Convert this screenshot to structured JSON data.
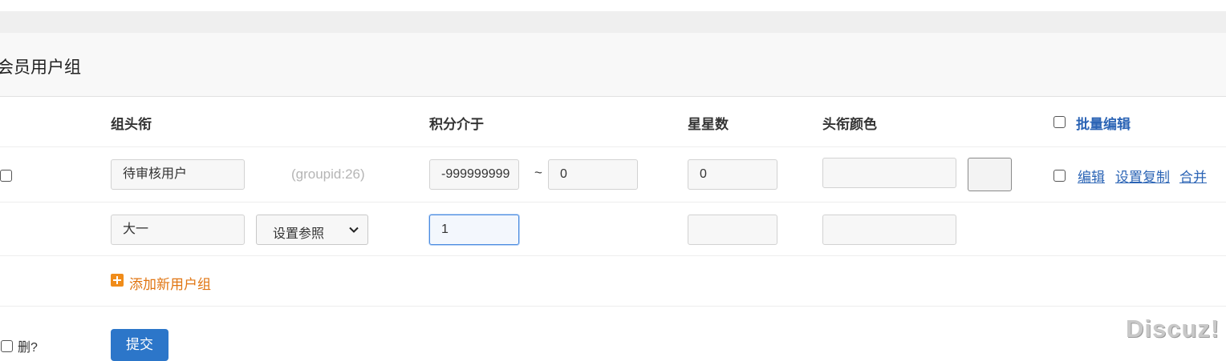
{
  "section": {
    "title": "会员用户组"
  },
  "columns": {
    "group_title": "组头衔",
    "credits_between": "积分介于",
    "stars": "星星数",
    "title_color": "头衔颜色",
    "batch_edit": "批量编辑"
  },
  "rows": [
    {
      "name": "待审核用户",
      "groupid": "(groupid:26)",
      "credits_min": "-999999999",
      "range_separator": "~",
      "credits_max": "0",
      "stars": "0",
      "color": "",
      "actions": {
        "edit": "编辑",
        "copy_settings": "设置复制",
        "merge": "合并"
      }
    },
    {
      "name": "大一",
      "reference": {
        "selected": "设置参照"
      },
      "credits_min": "1",
      "stars": "",
      "color": ""
    }
  ],
  "add_new": {
    "label": "添加新用户组"
  },
  "footer": {
    "delete_label": "删?",
    "submit_label": "提交"
  },
  "watermark": "Discuz!",
  "colors": {
    "accent": "#2c76c9",
    "link": "#2b64b5",
    "add_orange": "#e07512"
  }
}
